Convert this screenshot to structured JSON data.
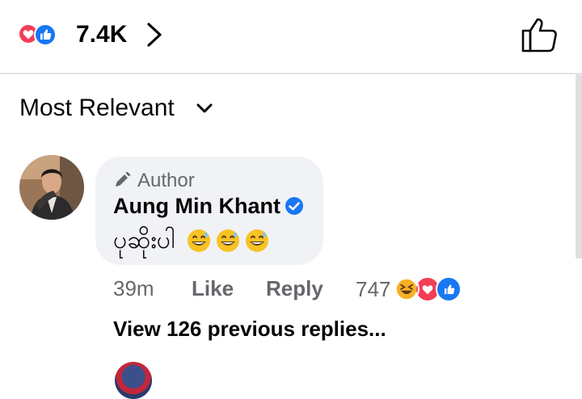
{
  "reactions_bar": {
    "count": "7.4K",
    "icons": [
      "heart-reaction-icon",
      "like-reaction-icon"
    ]
  },
  "sort": {
    "label": "Most Relevant"
  },
  "comment": {
    "author_tag": "Author",
    "author_name": "Aung Min Khant",
    "verified": true,
    "text": "ပုဆိုးပါ",
    "emojis": [
      "grinning-sweat-emoji",
      "grinning-sweat-emoji",
      "grinning-sweat-emoji"
    ],
    "time": "39m",
    "like_label": "Like",
    "reply_label": "Reply",
    "reaction_count": "747",
    "reaction_icons": [
      "laughing-reaction-icon",
      "heart-reaction-icon",
      "like-reaction-icon"
    ]
  },
  "replies": {
    "view_previous_label": "View 126 previous replies..."
  },
  "colors": {
    "like_blue": "#1877f2",
    "heart_red": "#f33e58",
    "haha_yellow": "#f7b125",
    "bubble_bg": "#f0f2f5",
    "meta_grey": "#65676b"
  }
}
